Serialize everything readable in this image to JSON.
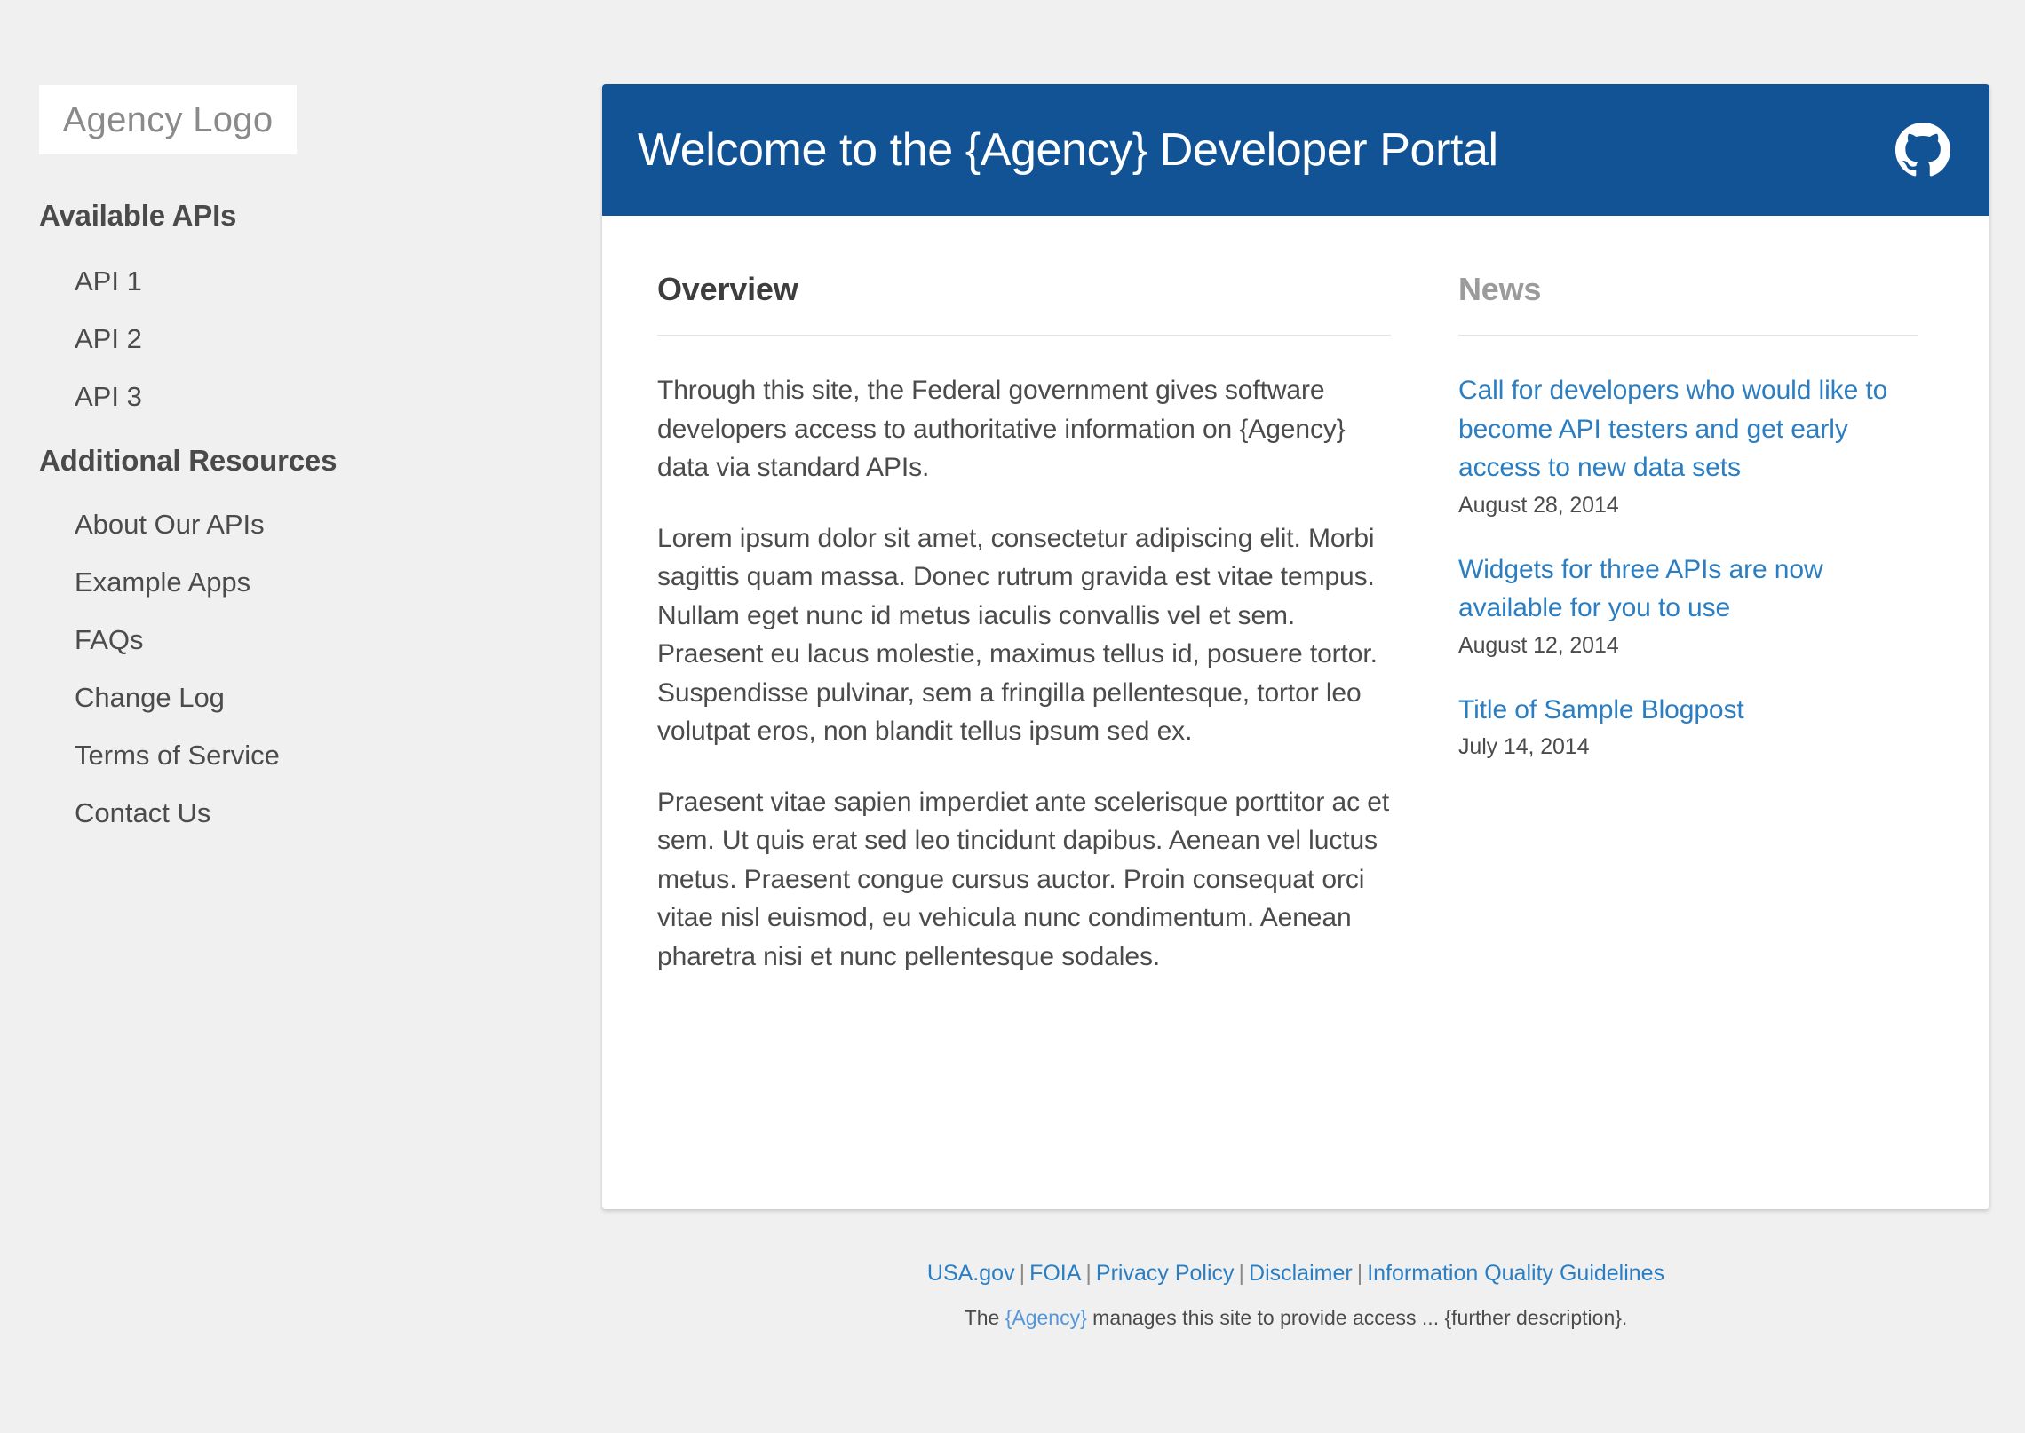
{
  "sidebar": {
    "logo_text": "Agency Logo",
    "sections": [
      {
        "heading": "Available APIs",
        "items": [
          {
            "label": "API 1"
          },
          {
            "label": "API 2"
          },
          {
            "label": "API 3"
          }
        ]
      },
      {
        "heading": "Additional Resources",
        "items": [
          {
            "label": "About Our APIs"
          },
          {
            "label": "Example Apps"
          },
          {
            "label": "FAQs"
          },
          {
            "label": "Change Log"
          },
          {
            "label": "Terms of Service"
          },
          {
            "label": "Contact Us"
          }
        ]
      }
    ]
  },
  "header": {
    "title": "Welcome to the {Agency} Developer Portal",
    "github_icon": "github-icon",
    "background_color": "#115394"
  },
  "main": {
    "overview": {
      "title": "Overview",
      "paragraphs": [
        "Through this site, the Federal government gives software developers access to authoritative information on {Agency} data via standard APIs.",
        "Lorem ipsum dolor sit amet, consectetur adipiscing elit. Morbi sagittis quam massa. Donec rutrum gravida est vitae tempus. Nullam eget nunc id metus iaculis convallis vel et sem. Praesent eu lacus molestie, maximus tellus id, posuere tortor. Suspendisse pulvinar, sem a fringilla pellentesque, tortor leo volutpat eros, non blandit tellus ipsum sed ex.",
        "Praesent vitae sapien imperdiet ante scelerisque porttitor ac et sem. Ut quis erat sed leo tincidunt dapibus. Aenean vel luctus metus. Praesent congue cursus auctor. Proin consequat orci vitae nisl euismod, eu vehicula nunc condimentum. Aenean pharetra nisi et nunc pellentesque sodales."
      ]
    },
    "news": {
      "title": "News",
      "items": [
        {
          "headline": "Call for developers who would like to become API testers and get early access to new data sets",
          "date": "August 28, 2014"
        },
        {
          "headline": "Widgets for three APIs are now available for you to use",
          "date": "August 12, 2014"
        },
        {
          "headline": "Title of Sample Blogpost",
          "date": "July 14, 2014"
        }
      ]
    }
  },
  "footer": {
    "links": [
      {
        "label": "USA.gov"
      },
      {
        "label": "FOIA"
      },
      {
        "label": "Privacy Policy"
      },
      {
        "label": "Disclaimer"
      },
      {
        "label": "Information Quality Guidelines"
      }
    ],
    "separator": "|",
    "note_prefix": "The ",
    "note_agency": "{Agency}",
    "note_suffix": " manages this site to provide access ... {further description}."
  },
  "colors": {
    "page_background": "#f0f0f0",
    "brand_blue": "#115394",
    "link_blue": "#2b7ec1",
    "text_gray": "#4b4b4b",
    "muted_gray": "#9b9b9b"
  }
}
